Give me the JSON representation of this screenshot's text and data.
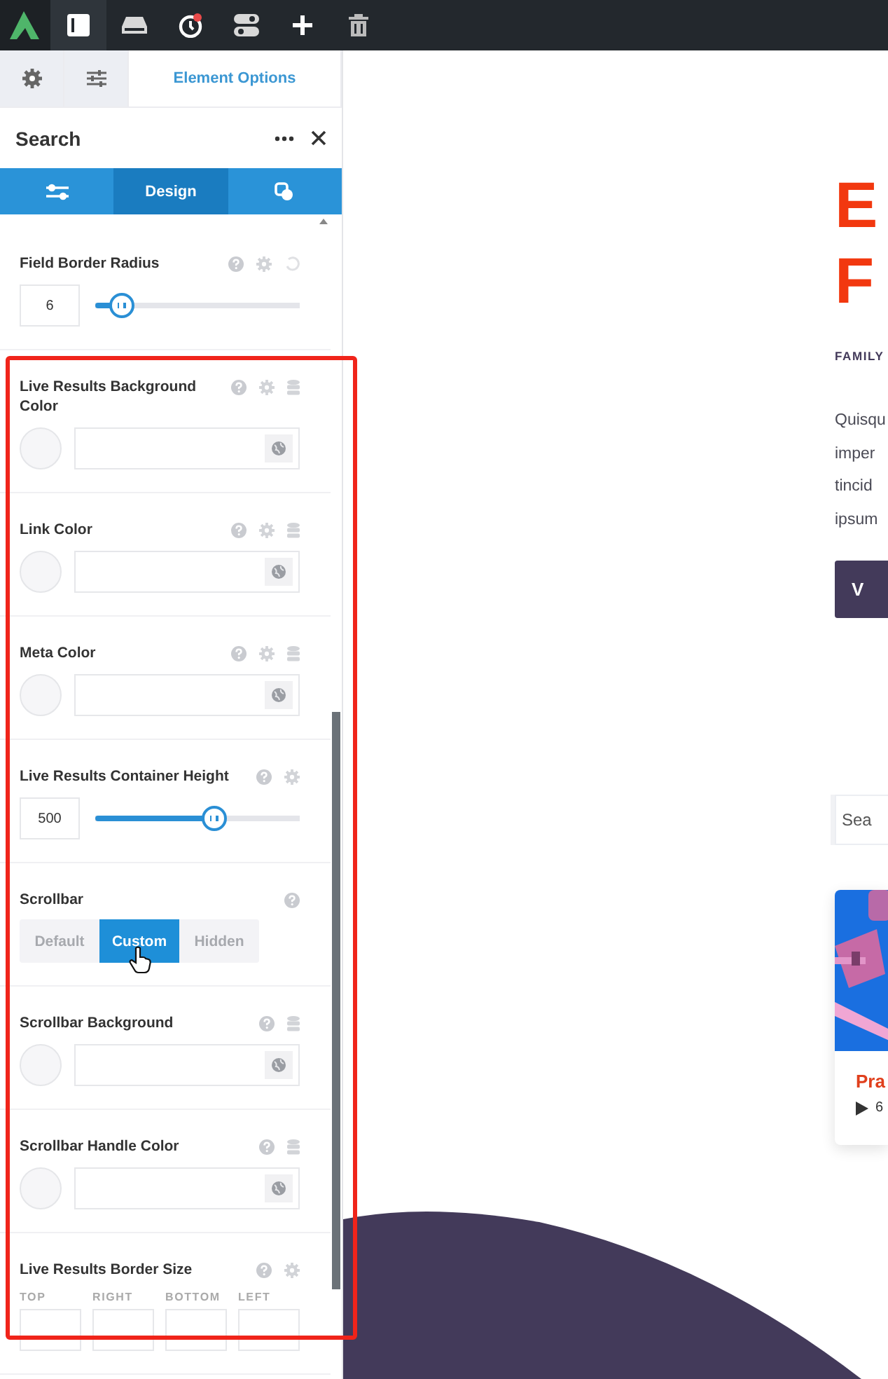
{
  "toolbar": [
    {
      "selected": true
    },
    {
      "selected": false
    },
    {
      "selected": false
    },
    {
      "selected": false
    },
    {
      "selected": false
    },
    {
      "selected": false
    }
  ],
  "panel_tabs": [
    {
      "selected": false
    },
    {
      "selected": false
    },
    {
      "label": "Element Options",
      "selected": true
    }
  ],
  "panel_title": "Search",
  "section_tabs": [
    {
      "selected": false
    },
    {
      "label": "Design",
      "selected": true
    },
    {
      "selected": false
    }
  ],
  "controls": [
    {
      "kind": "slider",
      "label": "Field Border Radius",
      "value": "6",
      "level": 0.13,
      "help": true,
      "settings": true,
      "reset": true,
      "dynamic": false
    },
    {
      "kind": "color",
      "label": "Live Results Background Color",
      "help": true,
      "settings": true,
      "reset": false,
      "dynamic": true
    },
    {
      "kind": "color",
      "label": "Link Color",
      "help": true,
      "settings": true,
      "reset": false,
      "dynamic": true
    },
    {
      "kind": "color",
      "label": "Meta Color",
      "help": true,
      "settings": true,
      "reset": false,
      "dynamic": true
    },
    {
      "kind": "slider",
      "label": "Live Results Container Height",
      "value": "500",
      "level": 0.58,
      "help": true,
      "settings": true,
      "reset": false,
      "dynamic": false
    },
    {
      "kind": "choice",
      "label": "Scrollbar",
      "help": true,
      "settings": false,
      "reset": false,
      "dynamic": false,
      "options": [
        {
          "label": "Default",
          "selected": false
        },
        {
          "label": "Custom",
          "selected": true
        },
        {
          "label": "Hidden",
          "selected": false
        }
      ]
    },
    {
      "kind": "color",
      "label": "Scrollbar Background",
      "help": true,
      "settings": false,
      "reset": false,
      "dynamic": true
    },
    {
      "kind": "color",
      "label": "Scrollbar Handle Color",
      "help": true,
      "settings": false,
      "reset": false,
      "dynamic": true
    },
    {
      "kind": "sides",
      "label": "Live Results Border Size",
      "help": true,
      "settings": true,
      "reset": false,
      "dynamic": false,
      "sides": [
        "TOP",
        "RIGHT",
        "BOTTOM",
        "LEFT"
      ]
    }
  ],
  "preview": {
    "heading": [
      "E",
      "F"
    ],
    "eyebrow": "FAMILY",
    "paragraph": [
      "Quisqu",
      "imper",
      "tincid",
      "ipsum"
    ],
    "button": "V",
    "search": {
      "placeholder": "Sea"
    },
    "card": {
      "title": "Pra",
      "meta": "6"
    }
  }
}
